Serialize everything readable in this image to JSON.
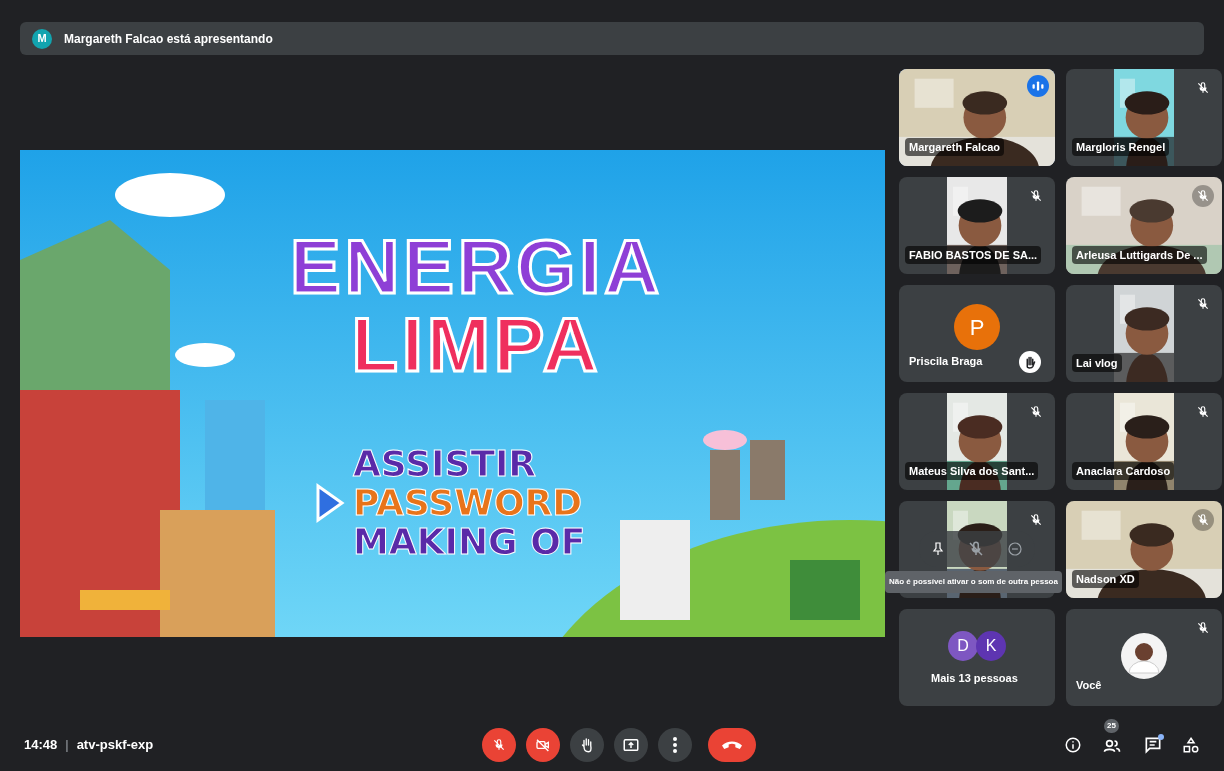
{
  "banner": {
    "initial": "M",
    "text": "Margareth Falcao está apresentando"
  },
  "slide": {
    "title_lines": [
      {
        "text": "ENERGIA",
        "color": "#8e3fd6"
      },
      {
        "text": "LIMPA",
        "color": "#ef2f5e"
      }
    ],
    "menu": [
      {
        "text": "ASSISTIR",
        "color": "#5a2aa8",
        "arrow": false
      },
      {
        "text": "PASSWORD",
        "color": "#e8741a",
        "arrow": true
      },
      {
        "text": "MAKING OF",
        "color": "#5a2aa8",
        "arrow": false
      }
    ]
  },
  "tiles": [
    {
      "kind": "video",
      "name": "Margareth Falcao",
      "speaking": true,
      "muted": false
    },
    {
      "kind": "portrait",
      "name": "Margloris Rengel",
      "speaking": false,
      "muted": true
    },
    {
      "kind": "portrait",
      "name": "FABIO BASTOS DE SA...",
      "speaking": false,
      "muted": true
    },
    {
      "kind": "video",
      "name": "Arleusa Luttigards De ...",
      "speaking": false,
      "muted": true
    },
    {
      "kind": "avatar",
      "name": "Priscila Braga",
      "initials": [
        "P"
      ],
      "hand_raised": true,
      "speaking": false,
      "muted": false
    },
    {
      "kind": "portrait",
      "name": "Lai vlog",
      "speaking": false,
      "muted": true
    },
    {
      "kind": "portrait",
      "name": "Mateus Silva dos Sant...",
      "speaking": false,
      "muted": true
    },
    {
      "kind": "portrait",
      "name": "Anaclara Cardoso",
      "speaking": false,
      "muted": true
    },
    {
      "kind": "portrait",
      "speaking": false,
      "muted": true,
      "hover": {
        "tooltip": "Não é possível ativar o som de outra pessoa"
      }
    },
    {
      "kind": "video",
      "name": "Nadson XD",
      "speaking": false,
      "muted": true
    },
    {
      "kind": "avatar",
      "name": "Mais 13 pessoas",
      "initials": [
        "D",
        "K"
      ],
      "speaking": false,
      "muted": false
    },
    {
      "kind": "self",
      "name": "Você",
      "speaking": false,
      "muted": true
    }
  ],
  "bottom": {
    "time": "14:48",
    "separator": "|",
    "code": "atv-pskf-exp",
    "controls": [
      {
        "kind": "mic",
        "off": true
      },
      {
        "kind": "camera",
        "off": true
      },
      {
        "kind": "hand",
        "off": false
      },
      {
        "kind": "present",
        "off": false
      },
      {
        "kind": "more",
        "off": false
      },
      {
        "kind": "hangup",
        "off": true
      }
    ],
    "people_count": "25",
    "chat_unread": true
  }
}
